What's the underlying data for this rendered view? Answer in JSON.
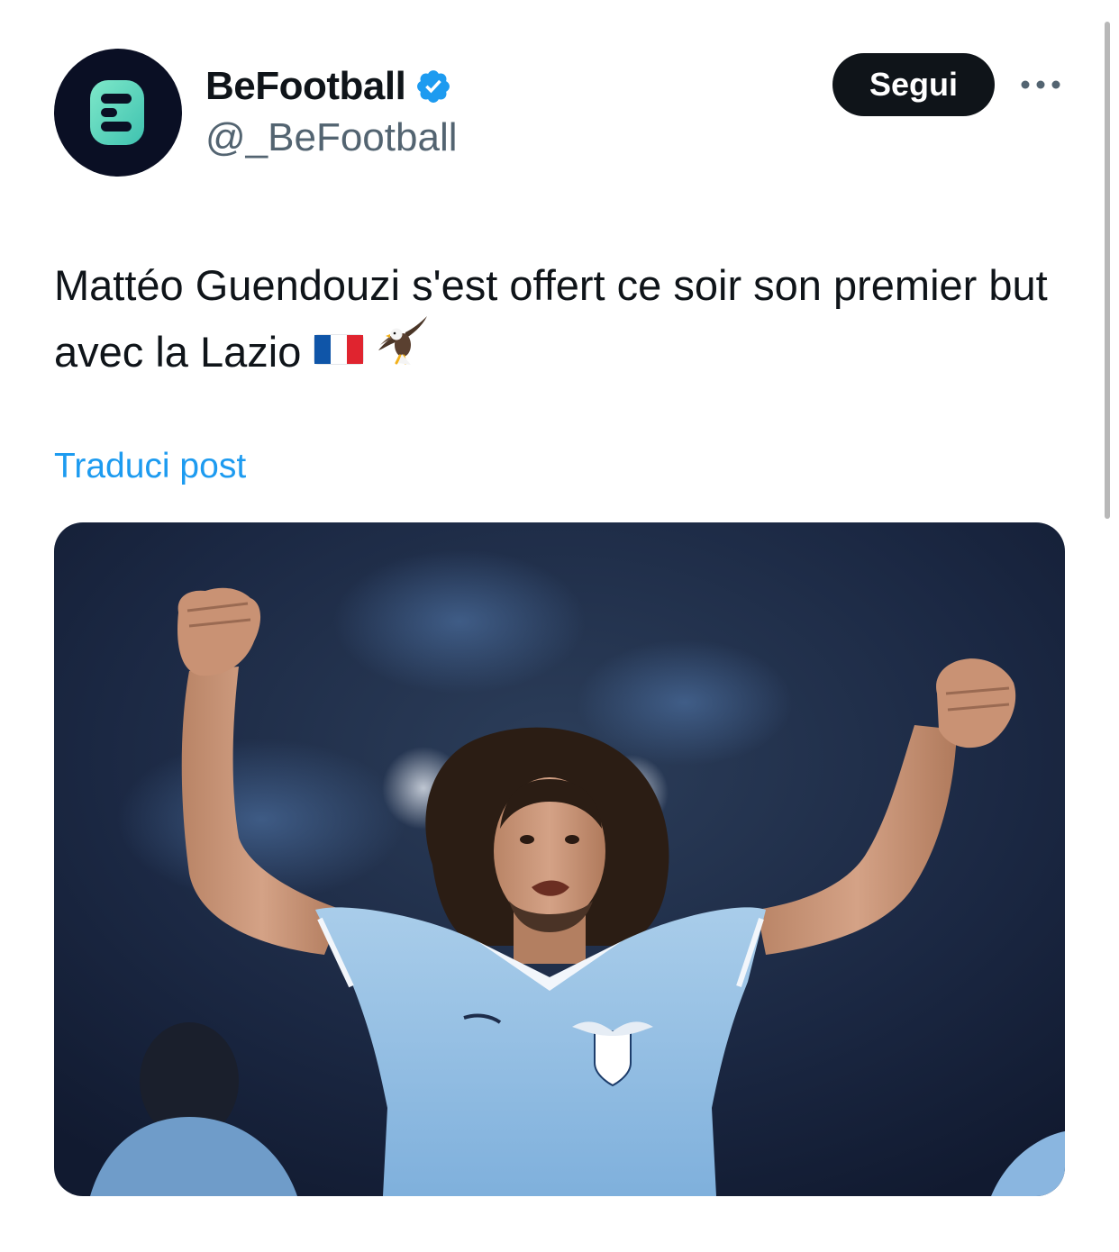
{
  "author": {
    "display_name": "BeFootball",
    "handle": "@_BeFootball",
    "avatar_icon": "befootball-logo-icon",
    "verified_icon": "verified-badge-icon",
    "verified_color": "#1d9bf0"
  },
  "actions": {
    "follow_label": "Segui",
    "more_icon": "more-options-icon"
  },
  "post": {
    "text": "Mattéo Guendouzi s'est offert ce soir son premier but avec la Lazio",
    "emojis": [
      "flag-france-icon",
      "eagle-icon"
    ],
    "translate_label": "Traduci post"
  },
  "media": {
    "kind": "photo",
    "icon": "player-celebration-photo"
  },
  "colors": {
    "text": "#0f1419",
    "secondary": "#536471",
    "link": "#1d9bf0",
    "button": "#0f1419"
  }
}
